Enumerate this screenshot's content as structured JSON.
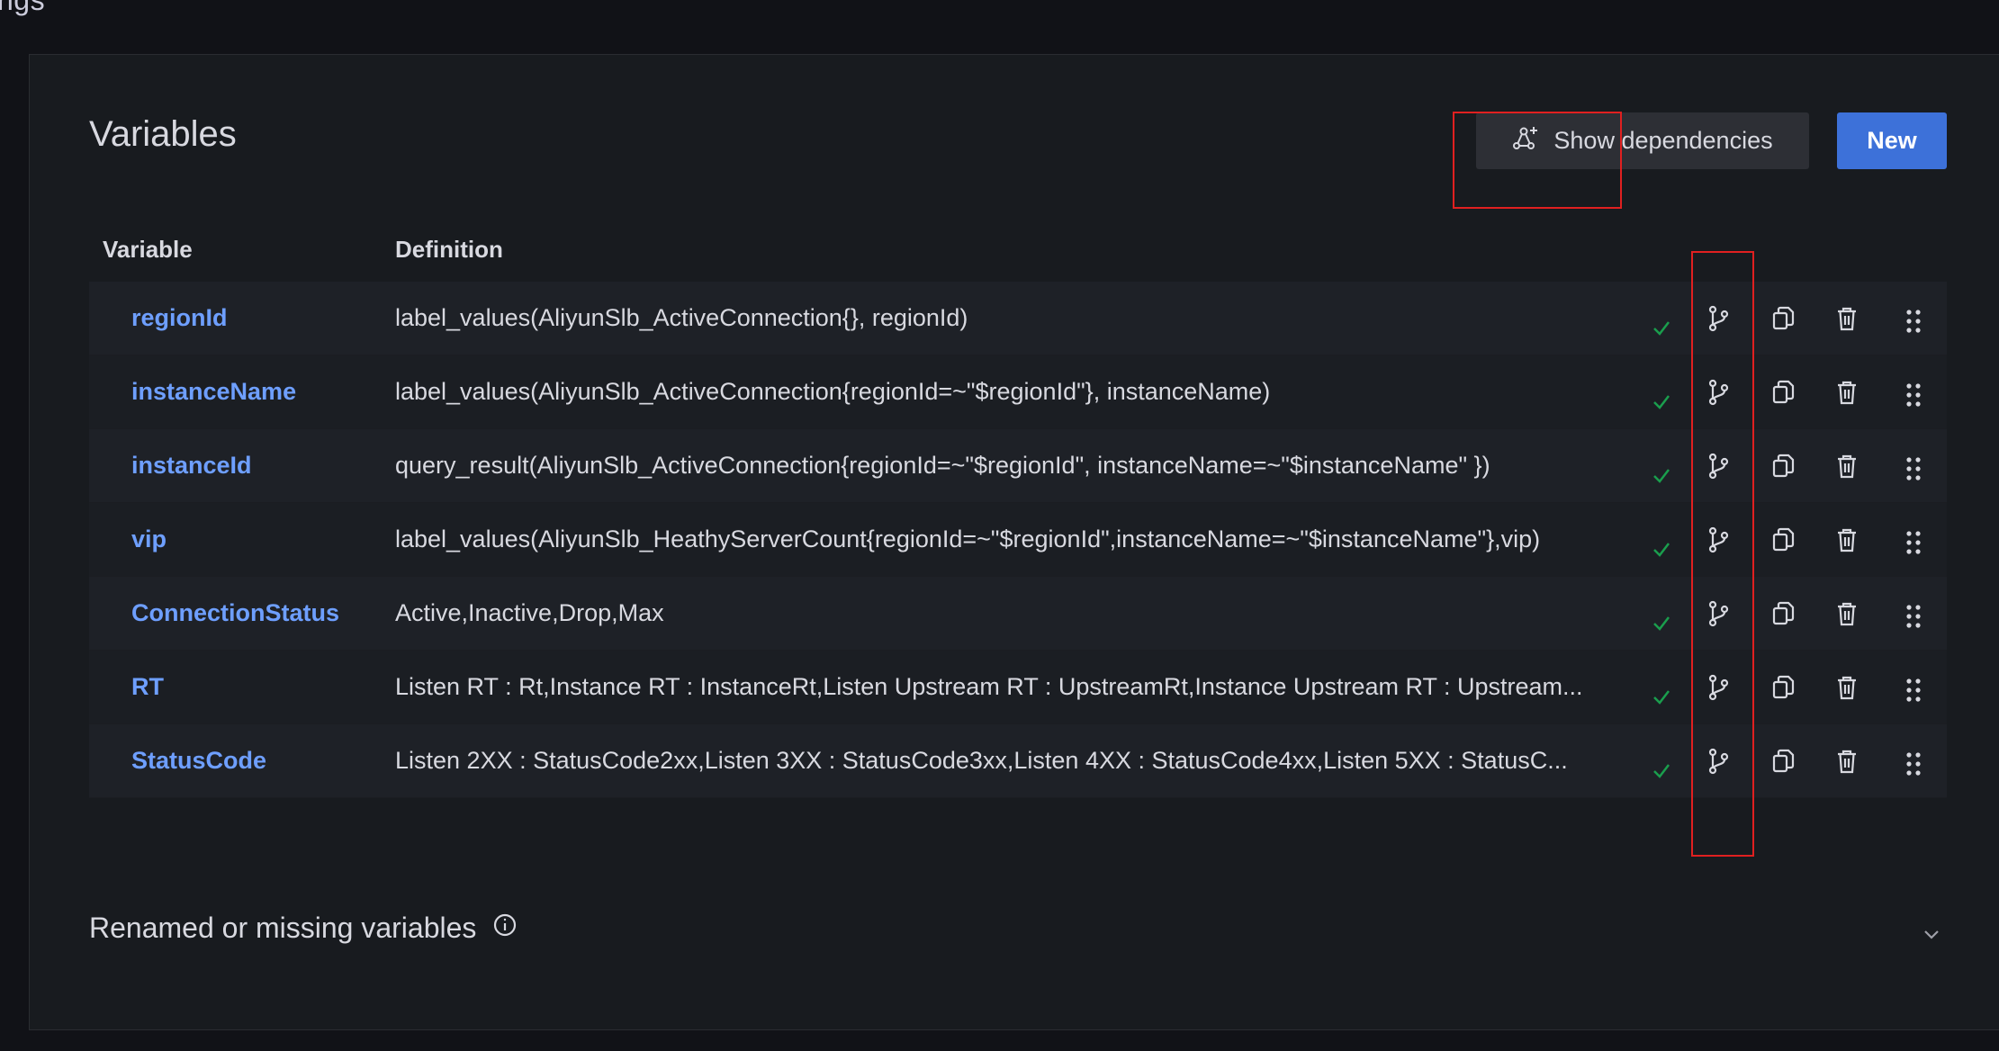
{
  "breadcrumb": "ngs",
  "section_title": "Variables",
  "buttons": {
    "show_dependencies": "Show dependencies",
    "new": "New"
  },
  "table": {
    "columns": [
      "Variable",
      "Definition"
    ],
    "rows": [
      {
        "name": "regionId",
        "definition": "label_values(AliyunSlb_ActiveConnection{}, regionId)"
      },
      {
        "name": "instanceName",
        "definition": "label_values(AliyunSlb_ActiveConnection{regionId=~\"$regionId\"}, instanceName)"
      },
      {
        "name": "instanceId",
        "definition": "query_result(AliyunSlb_ActiveConnection{regionId=~\"$regionId\", instanceName=~\"$instanceName\" })"
      },
      {
        "name": "vip",
        "definition": "label_values(AliyunSlb_HeathyServerCount{regionId=~\"$regionId\",instanceName=~\"$instanceName\"},vip)"
      },
      {
        "name": "ConnectionStatus",
        "definition": "Active,Inactive,Drop,Max"
      },
      {
        "name": "RT",
        "definition": "Listen RT : Rt,Instance RT : InstanceRt,Listen Upstream RT : UpstreamRt,Instance Upstream RT : Upstream..."
      },
      {
        "name": "StatusCode",
        "definition": "Listen 2XX : StatusCode2xx,Listen 3XX : StatusCode3xx,Listen 4XX : StatusCode4xx,Listen 5XX : StatusC..."
      }
    ]
  },
  "row_icons": [
    "check-icon",
    "branch-icon",
    "copy-icon",
    "trash-icon",
    "drag-handle-icon"
  ],
  "missing_section": {
    "label": "Renamed or missing variables",
    "icon": "info-icon",
    "expand_icon": "chevron-down-icon"
  },
  "colors": {
    "accent": "#3d71d9",
    "link": "#6e9fff",
    "success": "#1a9e4d",
    "highlight": "#e02020"
  }
}
